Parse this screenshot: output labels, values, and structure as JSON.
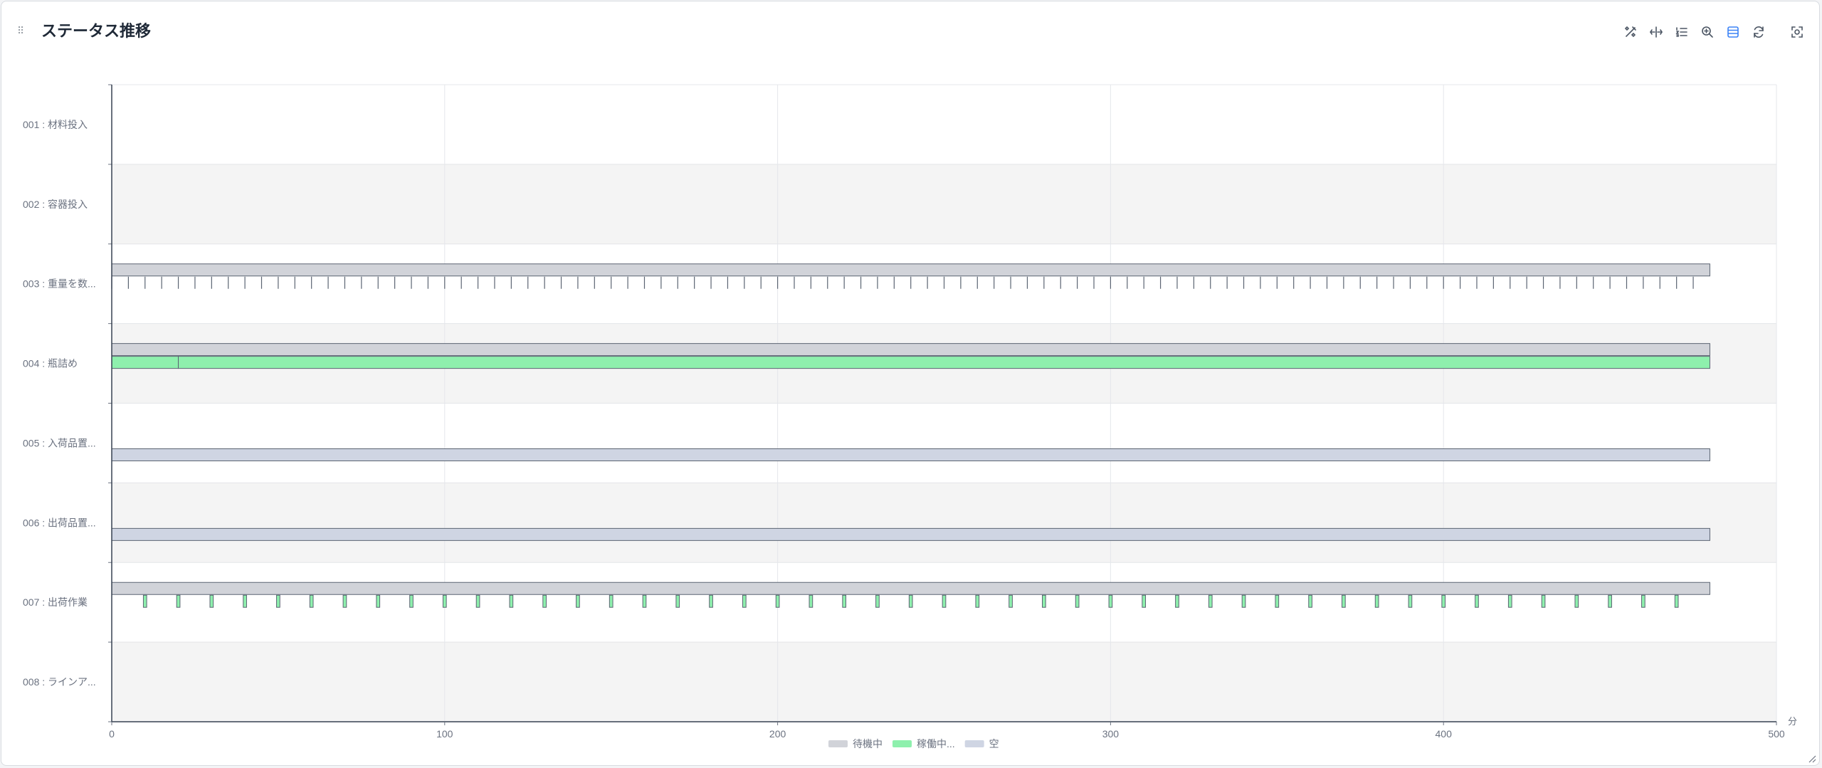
{
  "header": {
    "title": "ステータス推移"
  },
  "toolbar": [
    {
      "name": "wand-tool-icon"
    },
    {
      "name": "pan-tool-icon"
    },
    {
      "name": "list-tool-icon"
    },
    {
      "name": "zoom-tool-icon"
    },
    {
      "name": "table-view-icon",
      "active": true
    },
    {
      "name": "refresh-icon"
    },
    {
      "name": "save-image-icon"
    }
  ],
  "colors": {
    "waiting": "#d1d3d9",
    "working": "#8ef0ad",
    "empty": "#cfd5e3",
    "bar_border": "#5b6472",
    "active_icon": "#3b82f6",
    "icon": "#4b5563"
  },
  "chart_data": {
    "type": "gantt",
    "title": "ステータス推移",
    "xlabel": "分",
    "xlim": [
      0,
      500
    ],
    "xticks": [
      0,
      100,
      200,
      300,
      400,
      500
    ],
    "grid": true,
    "legend_position": "bottom-center",
    "categories": [
      "001 : 材料投入",
      "002 : 容器投入",
      "003 : 重量を数...",
      "004 : 瓶詰め",
      "005 : 入荷品置...",
      "006 : 出荷品置...",
      "007 : 出荷作業",
      "008 : ラインア..."
    ],
    "legend": [
      {
        "name": "待機中",
        "key": "waiting"
      },
      {
        "name": "稼働中...",
        "key": "working"
      },
      {
        "name": "空",
        "key": "empty"
      }
    ],
    "rows": [
      {
        "category": "001 : 材料投入",
        "segments": []
      },
      {
        "category": "002 : 容器投入",
        "segments": []
      },
      {
        "category": "003 : 重量を数...",
        "segments": [
          {
            "status": "waiting",
            "start": 0,
            "end": 480
          },
          {
            "status": "working",
            "every": 5,
            "from": 0,
            "to": 475,
            "duration": 0.1
          }
        ]
      },
      {
        "category": "004 : 瓶詰め",
        "segments": [
          {
            "status": "waiting",
            "start": 0,
            "end": 480
          },
          {
            "status": "working",
            "start": 0,
            "end": 20
          },
          {
            "status": "working",
            "start": 20,
            "end": 480
          }
        ]
      },
      {
        "category": "005 : 入荷品置...",
        "segments": [
          {
            "status": "empty",
            "start": 0,
            "end": 480
          }
        ]
      },
      {
        "category": "006 : 出荷品置...",
        "segments": [
          {
            "status": "empty",
            "start": 0,
            "end": 480
          }
        ]
      },
      {
        "category": "007 : 出荷作業",
        "segments": [
          {
            "status": "waiting",
            "start": 0,
            "end": 480
          },
          {
            "status": "working",
            "every": 10,
            "from": 10,
            "to": 470,
            "duration": 1
          }
        ]
      },
      {
        "category": "008 : ラインア...",
        "segments": []
      }
    ]
  }
}
